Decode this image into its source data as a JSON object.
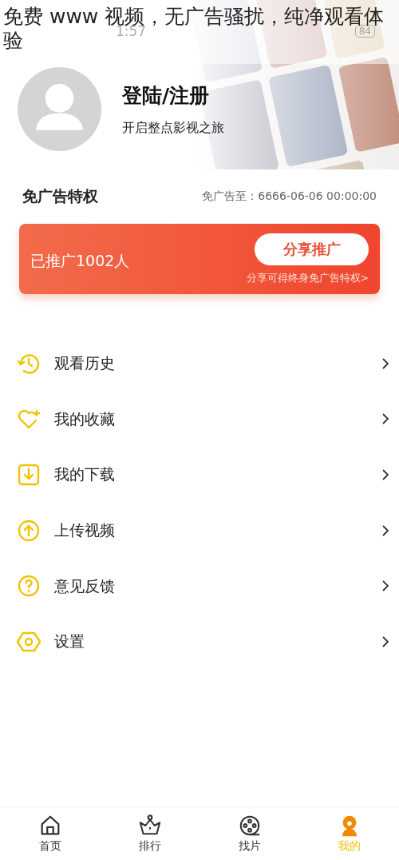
{
  "caption": "免费 www 视频，无广告骚扰，纯净观看体验",
  "status_bar": {
    "time": "1:57",
    "battery": "84"
  },
  "profile": {
    "title": "登陆/注册",
    "subtitle": "开启整点影视之旅"
  },
  "privilege": {
    "title": "免广告特权",
    "expiry": "免广告至：6666-06-06 00:00:00"
  },
  "promo": {
    "count_text": "已推广1002人",
    "button": "分享推广",
    "hint": "分享可得终身免广告特权>"
  },
  "menu": [
    {
      "kind": "history",
      "label": "观看历史"
    },
    {
      "kind": "favorite",
      "label": "我的收藏"
    },
    {
      "kind": "download",
      "label": "我的下载"
    },
    {
      "kind": "upload",
      "label": "上传视频"
    },
    {
      "kind": "feedback",
      "label": "意见反馈"
    },
    {
      "kind": "settings",
      "label": "设置"
    }
  ],
  "tabs": [
    {
      "kind": "home",
      "label": "首页",
      "selected": false
    },
    {
      "kind": "rank",
      "label": "排行",
      "selected": false
    },
    {
      "kind": "film",
      "label": "找片",
      "selected": false
    },
    {
      "kind": "me",
      "label": "我的",
      "selected": true
    }
  ]
}
